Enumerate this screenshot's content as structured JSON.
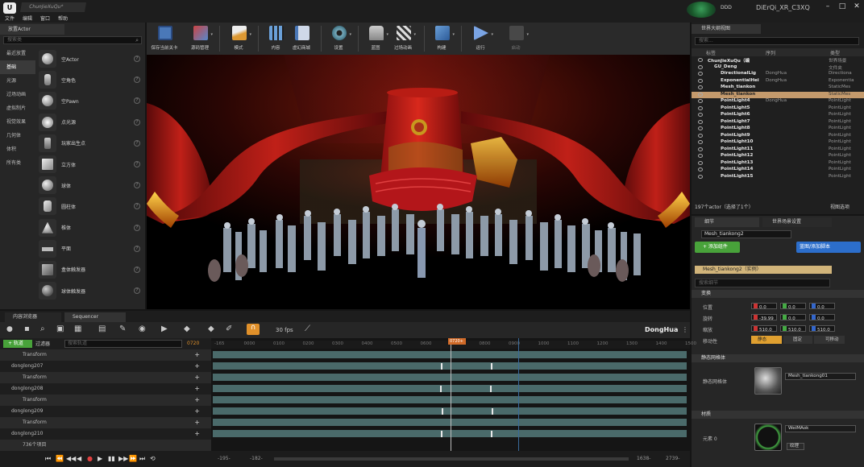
{
  "titlebar": {
    "doc_tab": "ChunJieXuQu*",
    "source_control": "DDD",
    "project_name": "DiErQi_XR_C3XQ"
  },
  "menu": [
    "文件",
    "编辑",
    "窗口",
    "帮助"
  ],
  "left_panel": {
    "tab": "放置Actor",
    "search_placeholder": "搜索类",
    "categories": [
      "最近放置",
      "基础",
      "光源",
      "过场动画",
      "虚拟制片",
      "视觉效果",
      "几何体",
      "体积",
      "所有类"
    ],
    "selected_category": 1,
    "items": [
      {
        "label": "空Actor",
        "icon": "sphere-icon"
      },
      {
        "label": "空角色",
        "icon": "character-icon"
      },
      {
        "label": "空Pawn",
        "icon": "pawn-icon"
      },
      {
        "label": "点光源",
        "icon": "point-light-icon"
      },
      {
        "label": "玩家出生点",
        "icon": "player-start-icon"
      },
      {
        "label": "立方体",
        "icon": "cube-icon"
      },
      {
        "label": "球体",
        "icon": "sphere-icon"
      },
      {
        "label": "圆柱体",
        "icon": "cylinder-icon"
      },
      {
        "label": "椎体",
        "icon": "cone-icon"
      },
      {
        "label": "平面",
        "icon": "plane-icon"
      },
      {
        "label": "盒体触发器",
        "icon": "box-trigger-icon"
      },
      {
        "label": "球体触发器",
        "icon": "sphere-trigger-icon"
      }
    ]
  },
  "toolbar": {
    "buttons": [
      {
        "label": "保存当前关卡",
        "icon": "save-icon"
      },
      {
        "label": "源码管理",
        "icon": "source-control-icon"
      },
      {
        "label": "模式",
        "icon": "modes-icon"
      },
      {
        "label": "内容",
        "icon": "content-icon"
      },
      {
        "label": "虚幻商城",
        "icon": "marketplace-icon"
      },
      {
        "label": "设置",
        "icon": "settings-icon"
      },
      {
        "label": "蓝图",
        "icon": "blueprint-icon"
      },
      {
        "label": "过场动画",
        "icon": "cinematics-icon"
      },
      {
        "label": "构建",
        "icon": "build-icon"
      },
      {
        "label": "运行",
        "icon": "play-icon"
      },
      {
        "label": "启动",
        "icon": "launch-icon"
      }
    ]
  },
  "outliner": {
    "tab": "世界大纲视图",
    "search_placeholder": "搜索...",
    "columns": [
      "标签",
      "序列",
      "类型"
    ],
    "rows": [
      {
        "name": "ChunJieXuQu（编",
        "seq": "",
        "type": "世界场景",
        "indent": 0
      },
      {
        "name": "GU_Deng",
        "seq": "",
        "type": "文件夹",
        "indent": 1
      },
      {
        "name": "DirectionalLig",
        "seq": "DongHua",
        "type": "Directiona",
        "indent": 2
      },
      {
        "name": "ExponentialHei",
        "seq": "DongHua",
        "type": "Exponentia",
        "indent": 2
      },
      {
        "name": "Mesh_tiankon",
        "seq": "",
        "type": "StaticMes",
        "indent": 2
      },
      {
        "name": "Mesh_tiankon",
        "seq": "",
        "type": "StaticMes",
        "indent": 2,
        "selected": true
      },
      {
        "name": "PointLight4",
        "seq": "DongHua",
        "type": "PointLight",
        "indent": 2
      },
      {
        "name": "PointLight5",
        "seq": "",
        "type": "PointLight",
        "indent": 2
      },
      {
        "name": "PointLight6",
        "seq": "",
        "type": "PointLight",
        "indent": 2
      },
      {
        "name": "PointLight7",
        "seq": "",
        "type": "PointLight",
        "indent": 2
      },
      {
        "name": "PointLight8",
        "seq": "",
        "type": "PointLight",
        "indent": 2
      },
      {
        "name": "PointLight9",
        "seq": "",
        "type": "PointLight",
        "indent": 2
      },
      {
        "name": "PointLight10",
        "seq": "",
        "type": "PointLight",
        "indent": 2
      },
      {
        "name": "PointLight11",
        "seq": "",
        "type": "PointLight",
        "indent": 2
      },
      {
        "name": "PointLight12",
        "seq": "",
        "type": "PointLight",
        "indent": 2
      },
      {
        "name": "PointLight13",
        "seq": "",
        "type": "PointLight",
        "indent": 2
      },
      {
        "name": "PointLight14",
        "seq": "",
        "type": "PointLight",
        "indent": 2
      },
      {
        "name": "PointLight15",
        "seq": "",
        "type": "PointLight",
        "indent": 2
      }
    ],
    "status": "197个actor（选择了1个）",
    "view_options": "视图选项"
  },
  "details": {
    "tab_details": "细节",
    "tab_world": "世界场景设置",
    "actor_name": "Mesh_tiankong2",
    "add_component": "+ 添加组件",
    "blueprint_button": "蓝图/添加脚本",
    "instance_row": "Mesh_tiankong2（实例）",
    "search_placeholder": "搜索细节",
    "transform_section": "变换",
    "location_label": "位置",
    "rotation_label": "旋转",
    "scale_label": "缩放",
    "mobility_label": "移动性",
    "location": [
      "0.0",
      "0.0",
      "0.0"
    ],
    "rotation": [
      "-39.99",
      "0.0",
      "0.0"
    ],
    "scale": [
      "510.0",
      "510.0",
      "510.0"
    ],
    "mobility": [
      "静态",
      "固定",
      "可移动"
    ],
    "mesh_section": "静态网格体",
    "mesh_label": "静态网格体",
    "mesh_value": "Mesh_tiankong01",
    "material_section": "材质",
    "material_label": "元素 0",
    "material_value": "WeiMAok",
    "material_sub": "纹理"
  },
  "bottom_tabs": [
    "内容浏览器",
    "Sequencer"
  ],
  "sequencer": {
    "fps": "30 fps",
    "sequence_name": "DongHua",
    "track_button": "+ 轨道",
    "filter_label": "过滤器",
    "search_placeholder": "搜索轨道",
    "current_frame": "0720",
    "playhead_label": "0720+",
    "tracks": [
      {
        "label": "Transform",
        "child": true
      },
      {
        "label": "donglong207",
        "child": false
      },
      {
        "label": "Transform",
        "child": true
      },
      {
        "label": "donglong208",
        "child": false
      },
      {
        "label": "Transform",
        "child": true
      },
      {
        "label": "donglong209",
        "child": false
      },
      {
        "label": "Transform",
        "child": true
      },
      {
        "label": "donglong210",
        "child": false
      },
      {
        "label": "736个项目",
        "child": true
      }
    ],
    "ruler_labels": [
      "-165",
      "0000",
      "0100",
      "0200",
      "0300",
      "0400",
      "0500",
      "0600",
      "0720+",
      "0800",
      "0900",
      "1000",
      "1100",
      "1200",
      "1300",
      "1400",
      "1500"
    ],
    "range_start": "-195-",
    "range_start2": "-182-",
    "range_end": "1638-",
    "range_end2": "2739-",
    "transport": [
      "⏮",
      "⏪",
      "◀◀",
      "◀",
      "●",
      "▶",
      "▮▮",
      "▶▶",
      "⏩",
      "⏭",
      "⟲"
    ]
  }
}
